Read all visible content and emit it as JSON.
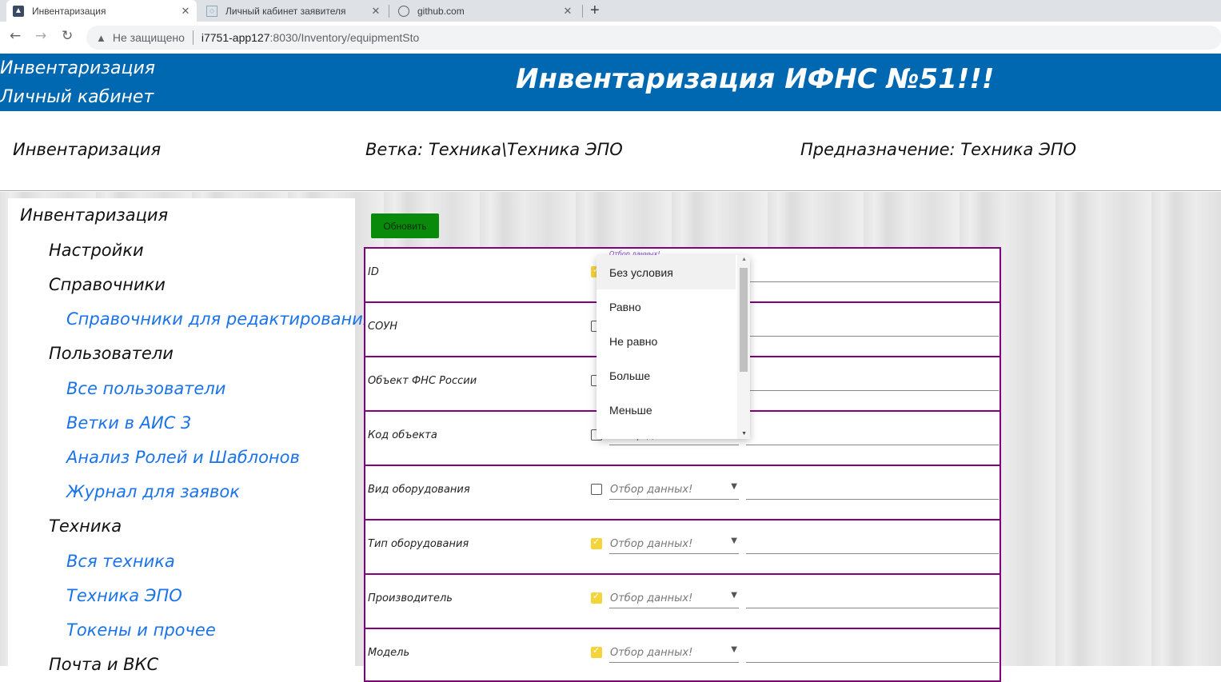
{
  "browser": {
    "tabs": [
      {
        "title": "Инвентаризация",
        "icon": "site-favicon",
        "active": true
      },
      {
        "title": "Личный кабинет заявителя",
        "icon": "page-favicon",
        "active": false
      },
      {
        "title": "github.com",
        "icon": "globe-icon",
        "active": false
      }
    ],
    "close_glyph": "✕",
    "new_tab_glyph": "+",
    "security_label": "Не защищено",
    "url_host": "i7751-app127",
    "url_rest": ":8030/Inventory/equipmentSto"
  },
  "header": {
    "nav_inventory": "Инвентаризация",
    "nav_cabinet": "Личный кабинет",
    "title": "Инвентаризация ИФНС №51!!!"
  },
  "info": {
    "section": "Инвентаризация",
    "branch": "Ветка: Техника\\Техника ЭПО",
    "purpose": "Предназначение: Техника ЭПО"
  },
  "sidebar": {
    "items": [
      {
        "label": "Инвентаризация",
        "level": 0
      },
      {
        "label": "Настройки",
        "level": 1
      },
      {
        "label": "Справочники",
        "level": 1
      },
      {
        "label": "Справочники для редактирования",
        "level": 2
      },
      {
        "label": "Пользователи",
        "level": 1
      },
      {
        "label": "Все пользователи",
        "level": 2
      },
      {
        "label": "Ветки в АИС 3",
        "level": 2
      },
      {
        "label": "Анализ Ролей и Шаблонов",
        "level": 2
      },
      {
        "label": "Журнал для заявок",
        "level": 2
      },
      {
        "label": "Техника",
        "level": 1
      },
      {
        "label": "Вся техника",
        "level": 2
      },
      {
        "label": "Техника ЭПО",
        "level": 2
      },
      {
        "label": "Токены и прочее",
        "level": 2
      },
      {
        "label": "Почта и ВКС",
        "level": 1
      }
    ]
  },
  "toolbar": {
    "refresh_label": "Обновить"
  },
  "filter_placeholder": "Отбор данных!",
  "fields": [
    {
      "label": "ID",
      "checked": true
    },
    {
      "label": "СОУН",
      "checked": false
    },
    {
      "label": "Объект ФНС России",
      "checked": false
    },
    {
      "label": "Код объекта",
      "checked": false
    },
    {
      "label": "Вид оборудования",
      "checked": false
    },
    {
      "label": "Тип оборудования",
      "checked": true
    },
    {
      "label": "Производитель",
      "checked": true
    },
    {
      "label": "Модель",
      "checked": true
    }
  ],
  "dropdown": {
    "options": [
      "Без условия",
      "Равно",
      "Не равно",
      "Больше",
      "Меньше"
    ],
    "highlighted": "Без условия"
  }
}
